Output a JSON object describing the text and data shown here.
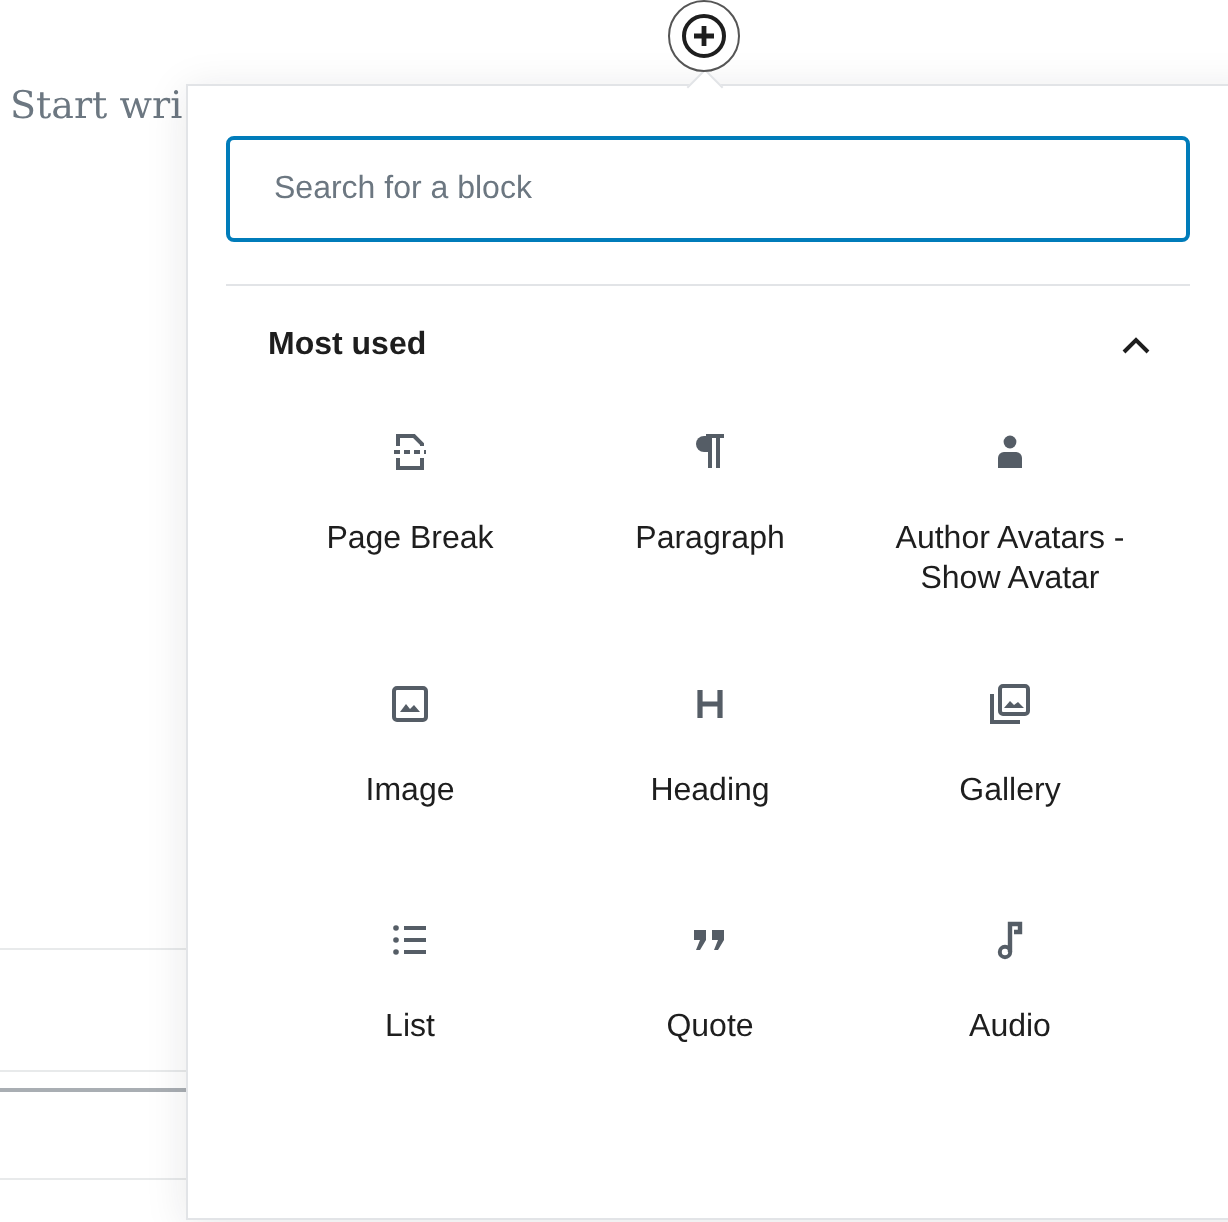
{
  "editor": {
    "placeholder_text": "Start wri"
  },
  "inserter": {
    "search": {
      "placeholder": "Search for a block"
    },
    "section": {
      "title": "Most used",
      "expanded": true
    },
    "blocks": [
      {
        "label": "Page Break",
        "kind": "pagebreak"
      },
      {
        "label": "Paragraph",
        "kind": "paragraph"
      },
      {
        "label": "Author Avatars - Show Avatar",
        "kind": "avatar"
      },
      {
        "label": "Image",
        "kind": "image"
      },
      {
        "label": "Heading",
        "kind": "heading"
      },
      {
        "label": "Gallery",
        "kind": "gallery"
      },
      {
        "label": "List",
        "kind": "list"
      },
      {
        "label": "Quote",
        "kind": "quote"
      },
      {
        "label": "Audio",
        "kind": "audio"
      }
    ]
  }
}
